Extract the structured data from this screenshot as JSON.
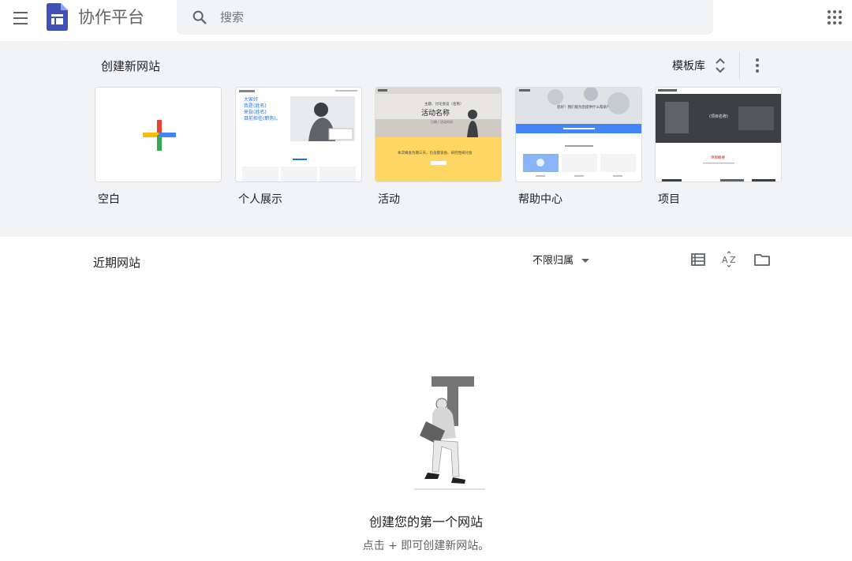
{
  "header": {
    "app_title": "协作平台",
    "search_placeholder": "搜索",
    "menu_icon": "hamburger-menu-icon",
    "apps_icon": "apps-grid-icon",
    "brand_color": "#3f51b5"
  },
  "templates": {
    "title": "创建新网站",
    "library_label": "模板库",
    "cards": [
      {
        "label": "空白"
      },
      {
        "label": "个人展示",
        "preview": {
          "lines": [
            "大家好",
            "我是(姓名)",
            "来自(姓名)",
            "目前担任(职务)。"
          ]
        }
      },
      {
        "label": "活动",
        "preview": {
          "header": "主题、讨论会议（名称）",
          "heading": "活动名称",
          "date": "日期 / 活动时间",
          "banner_text": "本次峰会为期三天，包含座谈会、研究性研讨会"
        }
      },
      {
        "label": "帮助中心",
        "preview": {
          "heading": "您好！我们能为您提供什么帮助？"
        }
      },
      {
        "label": "项目",
        "preview": {
          "heading": "(项目名称)",
          "sub_heading": "项目概要"
        }
      }
    ],
    "accent_colors": {
      "blue": "#4285f4",
      "red": "#ea4335",
      "yellow": "#fbbc04",
      "green": "#34a853",
      "event_yellow": "#fdd663"
    }
  },
  "recent": {
    "title": "近期网站",
    "owner_filter": "不限归属",
    "icons": [
      "list-view-icon",
      "sort-az-icon",
      "folder-icon"
    ]
  },
  "empty_state": {
    "title": "创建您的第一个网站",
    "subtitle": "点击 + 即可创建新网站。"
  }
}
